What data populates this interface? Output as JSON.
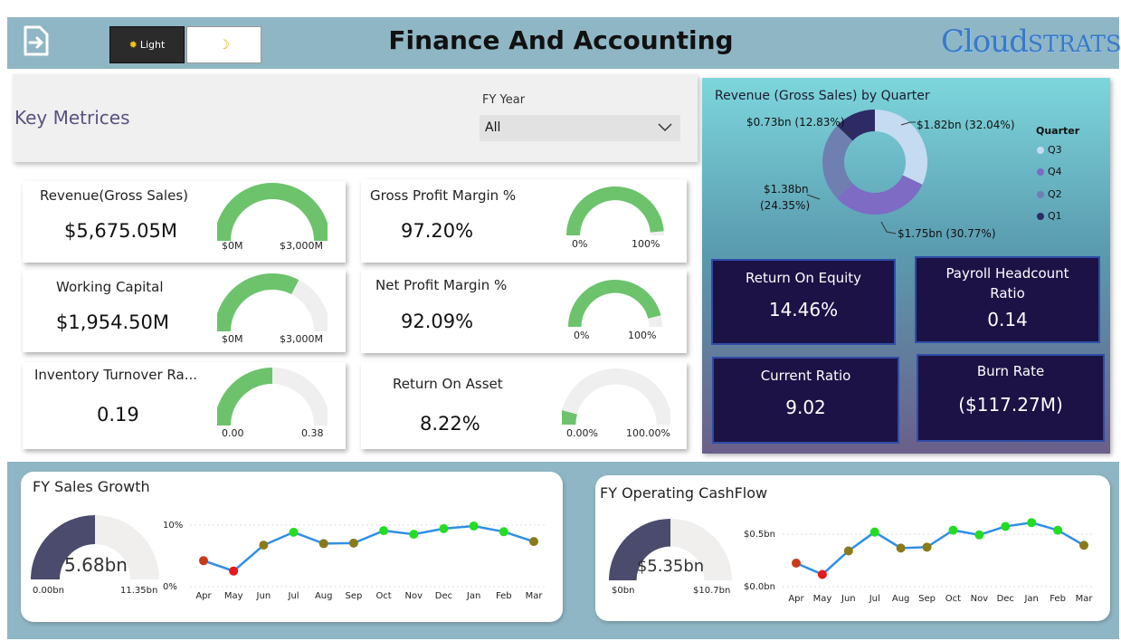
{
  "header": {
    "title": "Finance And Accounting",
    "theme_light_label": "Light",
    "logo_main": "Cloud",
    "logo_small": "STRATS"
  },
  "filters": {
    "section_label": "Key Metrices",
    "fy_label": "FY Year",
    "fy_value": "All"
  },
  "metrics": {
    "revenue": {
      "title": "Revenue(Gross Sales)",
      "value": "$5,675.05M",
      "min": "$0M",
      "max": "$3,000M",
      "fill": 1.0
    },
    "gross_margin": {
      "title": "Gross Profit Margin %",
      "value": "97.20%",
      "min": "0%",
      "max": "100%",
      "fill": 0.972
    },
    "working_capital": {
      "title": "Working Capital",
      "value": "$1,954.50M",
      "min": "$0M",
      "max": "$3,000M",
      "fill": 0.6515
    },
    "net_margin": {
      "title": "Net Profit Margin %",
      "value": "92.09%",
      "min": "0%",
      "max": "100%",
      "fill": 0.9209
    },
    "inventory": {
      "title": "Inventory Turnover Ra...",
      "value": "0.19",
      "min": "0.00",
      "max": "0.38",
      "fill": 0.5
    },
    "roa": {
      "title": "Return On Asset",
      "value": "8.22%",
      "min": "0.00%",
      "max": "100.00%",
      "fill": 0.0822
    }
  },
  "revenue_by_quarter": {
    "title": "Revenue (Gross Sales) by Quarter",
    "legend_title": "Quarter",
    "slices": [
      {
        "name": "Q3",
        "label": "$1.82bn (32.04%)",
        "percent": 32.04,
        "color": "#c5dbf2"
      },
      {
        "name": "Q4",
        "label": "$1.75bn (30.77%)",
        "percent": 30.77,
        "color": "#7d6bc4"
      },
      {
        "name": "Q2",
        "label_line1": "$1.38bn",
        "label_line2": "(24.35%)",
        "percent": 24.35,
        "color": "#6f7fb0"
      },
      {
        "name": "Q1",
        "label": "$0.73bn (12.83%)",
        "percent": 12.83,
        "color": "#2d2a66"
      }
    ]
  },
  "kpis": {
    "roe": {
      "title": "Return On Equity",
      "value": "14.46%"
    },
    "payroll": {
      "title_line1": "Payroll Headcount",
      "title_line2": "Ratio",
      "value": "0.14"
    },
    "current_ratio": {
      "title": "Current Ratio",
      "value": "9.02"
    },
    "burn_rate": {
      "title": "Burn Rate",
      "value": "($117.27M)"
    }
  },
  "sales_growth": {
    "title": "FY Sales Growth",
    "gauge_value": "5.68bn",
    "gauge_min": "0.00bn",
    "gauge_max": "11.35bn",
    "gauge_fill": 0.5,
    "y_ticks": [
      "10%",
      "0%"
    ]
  },
  "operating_cashflow": {
    "title": "FY Operating CashFlow",
    "gauge_value": "$5.35bn",
    "gauge_min": "$0bn",
    "gauge_max": "$10.7bn",
    "gauge_fill": 0.5,
    "y_ticks": [
      "$0.5bn",
      "$0.0bn"
    ]
  },
  "chart_data": [
    {
      "type": "line",
      "title": "FY Sales Growth",
      "x": [
        "Apr",
        "May",
        "Jun",
        "Jul",
        "Aug",
        "Sep",
        "Oct",
        "Nov",
        "Dec",
        "Jan",
        "Feb",
        "Mar"
      ],
      "values": [
        4.5,
        2.5,
        7.5,
        10.0,
        7.8,
        7.9,
        10.3,
        9.6,
        10.7,
        11.2,
        10.1,
        8.2
      ],
      "ylim": [
        0,
        14
      ],
      "point_colors": [
        "#c83a1a",
        "#e8181c",
        "#8a7a1a",
        "#22dd22",
        "#8a7a1a",
        "#8a7a1a",
        "#22dd22",
        "#22dd22",
        "#22dd22",
        "#22dd22",
        "#22dd22",
        "#8a7a1a"
      ],
      "line_color": "#2f8fe8"
    },
    {
      "type": "line",
      "title": "FY Operating CashFlow",
      "x": [
        "Apr",
        "May",
        "Jun",
        "Jul",
        "Aug",
        "Sep",
        "Oct",
        "Nov",
        "Dec",
        "Jan",
        "Feb",
        "Mar"
      ],
      "values": [
        0.25,
        0.13,
        0.38,
        0.58,
        0.41,
        0.42,
        0.6,
        0.55,
        0.64,
        0.68,
        0.6,
        0.44
      ],
      "ylim": [
        0,
        0.75
      ],
      "point_colors": [
        "#c83a1a",
        "#e8181c",
        "#8a7a1a",
        "#22dd22",
        "#8a7a1a",
        "#8a7a1a",
        "#22dd22",
        "#22dd22",
        "#22dd22",
        "#22dd22",
        "#22dd22",
        "#8a7a1a"
      ],
      "line_color": "#2f8fe8"
    }
  ]
}
